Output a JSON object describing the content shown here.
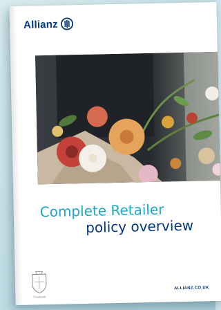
{
  "brochure": {
    "brand_name": "Allianz",
    "title_line_1": "Complete Retailer",
    "title_line_2": "policy overview",
    "website": "ALLIANZ.CO.UK",
    "crest_label": "Chartered"
  },
  "colors": {
    "brand_navy": "#003781",
    "accent_teal": "#1aa8c9",
    "background": "#cfe4ea"
  },
  "icons": {
    "logo": "allianz-eagle-mark",
    "crest": "chartered-insurer-crest"
  }
}
